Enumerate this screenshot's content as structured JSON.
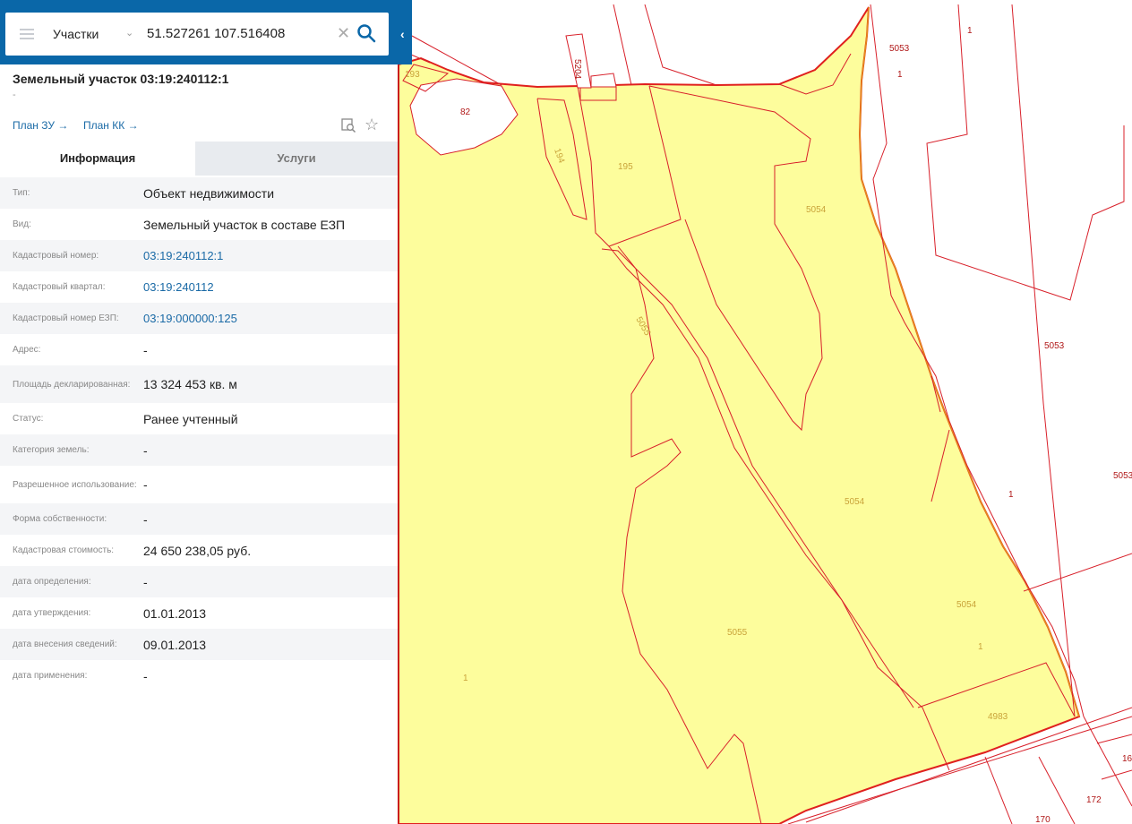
{
  "search": {
    "layer": "Участки",
    "query": "51.527261 107.516408"
  },
  "parcel": {
    "title": "Земельный участок 03:19:240112:1",
    "subtitle": "-",
    "plan_zu": "План ЗУ →",
    "plan_kk": "План КК →"
  },
  "tabs": {
    "info": "Информация",
    "services": "Услуги"
  },
  "attributes": [
    {
      "label": "Тип:",
      "value": "Объект недвижимости"
    },
    {
      "label": "Вид:",
      "value": "Земельный участок в составе ЕЗП"
    },
    {
      "label": "Кадастровый номер:",
      "value": "03:19:240112:1"
    },
    {
      "label": "Кадастровый квартал:",
      "value": "03:19:240112"
    },
    {
      "label": "Кадастровый номер ЕЗП:",
      "value": "03:19:000000:125"
    },
    {
      "label": "Адрес:",
      "value": "-"
    },
    {
      "label": "Площадь декларированная:",
      "value": "13 324 453 кв. м"
    },
    {
      "label": "Статус:",
      "value": "Ранее учтенный"
    },
    {
      "label": "Категория земель:",
      "value": "-"
    },
    {
      "label": "Разрешенное использование:",
      "value": "-"
    },
    {
      "label": "Форма собственности:",
      "value": "-"
    },
    {
      "label": "Кадастровая стоимость:",
      "value": "24 650 238,05 руб."
    },
    {
      "label": "дата определения:",
      "value": "-"
    },
    {
      "label": "дата утверждения:",
      "value": "01.01.2013"
    },
    {
      "label": "дата внесения сведений:",
      "value": "09.01.2013"
    },
    {
      "label": "дата применения:",
      "value": "-"
    }
  ],
  "map_labels": {
    "l193": "193",
    "l82": "82",
    "l5204": "5204",
    "l194": "194",
    "l195": "195",
    "l5054a": "5054",
    "l5053a": "5053",
    "l1a": "1",
    "l1b": "1",
    "l5055a": "5055",
    "l5053b": "5053",
    "l5054b": "5054",
    "l5053c": "5053",
    "l1c": "1",
    "l5054c": "5054",
    "l1d": "1",
    "l5055b": "5055",
    "l1e": "1",
    "l4983": "4983",
    "l172": "172",
    "l170": "170",
    "l16": "16"
  },
  "colors": {
    "parcel_fill": "#fdfd9c",
    "parcel_border": "#e0201e",
    "selected_border": "#e58c1a",
    "brand": "#0a67a8",
    "link": "#1a6aa6"
  }
}
